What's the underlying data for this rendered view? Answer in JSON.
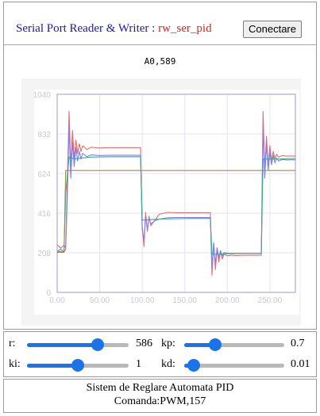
{
  "header": {
    "title": "Serial Port Reader & Writer : ",
    "port_name": "rw_ser_pid",
    "connect_label": "Conectare"
  },
  "received_line": "A0,589",
  "chart_data": {
    "type": "line",
    "title": "",
    "xlabel": "",
    "ylabel": "",
    "xlim": [
      0,
      280
    ],
    "ylim": [
      0,
      1040
    ],
    "xticks": [
      "0.00",
      "50.00",
      "100.00",
      "150.00",
      "200.00",
      "250.00"
    ],
    "yticks": [
      "0",
      "208",
      "416",
      "624",
      "832",
      "1040"
    ],
    "grid": true,
    "legend": "none",
    "series": [
      {
        "color": "#e86a6a",
        "x": [
          0,
          4,
          8,
          10,
          12,
          14,
          16,
          18,
          20,
          22,
          24,
          26,
          28,
          30,
          35,
          40,
          50,
          60,
          70,
          80,
          90,
          98,
          100,
          102,
          104,
          106,
          108,
          110,
          115,
          120,
          130,
          140,
          150,
          160,
          170,
          180,
          182,
          184,
          186,
          188,
          190,
          192,
          194,
          196,
          200,
          205,
          210,
          220,
          230,
          240,
          242,
          244,
          246,
          248,
          250,
          252,
          254,
          256,
          258,
          260,
          265,
          270,
          275,
          280
        ],
        "y": [
          250,
          232,
          248,
          235,
          600,
          950,
          660,
          850,
          700,
          800,
          730,
          780,
          740,
          770,
          750,
          762,
          758,
          760,
          760,
          760,
          760,
          760,
          350,
          240,
          420,
          320,
          400,
          350,
          380,
          410,
          420,
          418,
          418,
          418,
          418,
          418,
          90,
          260,
          120,
          230,
          160,
          215,
          175,
          200,
          192,
          196,
          194,
          195,
          195,
          195,
          950,
          630,
          820,
          660,
          770,
          690,
          740,
          700,
          725,
          710,
          718,
          715,
          716,
          716
        ]
      },
      {
        "color": "#7f7fe8",
        "x": [
          0,
          4,
          8,
          10,
          12,
          14,
          16,
          18,
          20,
          22,
          24,
          26,
          28,
          30,
          35,
          40,
          50,
          60,
          70,
          80,
          90,
          98,
          100,
          102,
          104,
          106,
          108,
          110,
          115,
          120,
          130,
          140,
          150,
          160,
          170,
          180,
          182,
          184,
          186,
          188,
          190,
          192,
          194,
          196,
          200,
          205,
          210,
          220,
          230,
          240,
          242,
          244,
          246,
          248,
          250,
          252,
          254,
          256,
          258,
          260,
          265,
          270,
          275,
          280
        ],
        "y": [
          215,
          228,
          212,
          225,
          520,
          880,
          600,
          790,
          660,
          760,
          690,
          740,
          700,
          730,
          712,
          722,
          718,
          720,
          720,
          720,
          720,
          720,
          330,
          280,
          400,
          330,
          390,
          360,
          376,
          385,
          392,
          393,
          393,
          393,
          393,
          393,
          130,
          260,
          150,
          235,
          180,
          220,
          190,
          210,
          205,
          206,
          205,
          205,
          205,
          205,
          880,
          600,
          780,
          640,
          740,
          670,
          720,
          680,
          705,
          690,
          698,
          695,
          696,
          696
        ]
      },
      {
        "color": "#3ea88a",
        "x": [
          0,
          8,
          10,
          14,
          20,
          30,
          40,
          60,
          80,
          98,
          100,
          104,
          110,
          120,
          140,
          160,
          180,
          182,
          186,
          190,
          200,
          220,
          240,
          242,
          248,
          260,
          270,
          280
        ],
        "y": [
          215,
          215,
          520,
          710,
          700,
          706,
          710,
          712,
          712,
          712,
          380,
          380,
          382,
          385,
          387,
          388,
          388,
          200,
          200,
          200,
          203,
          205,
          205,
          700,
          700,
          700,
          702,
          703
        ]
      },
      {
        "color": "#9a8f4a",
        "x": [
          0,
          8,
          10,
          100,
          101,
          180,
          181,
          240,
          241,
          280
        ],
        "y": [
          210,
          210,
          640,
          640,
          640,
          640,
          640,
          640,
          640,
          640
        ]
      }
    ]
  },
  "controls": {
    "r": {
      "label": "r:",
      "value": "586",
      "fraction": 0.72
    },
    "kp": {
      "label": "kp:",
      "value": "0.7",
      "fraction": 0.28
    },
    "ki": {
      "label": "ki:",
      "value": "1",
      "fraction": 0.5
    },
    "kd": {
      "label": "kd:",
      "value": "0.01",
      "fraction": 0.04
    }
  },
  "status": {
    "title": "Sistem de Reglare Automata PID",
    "command": "Comanda:PWM,157"
  }
}
